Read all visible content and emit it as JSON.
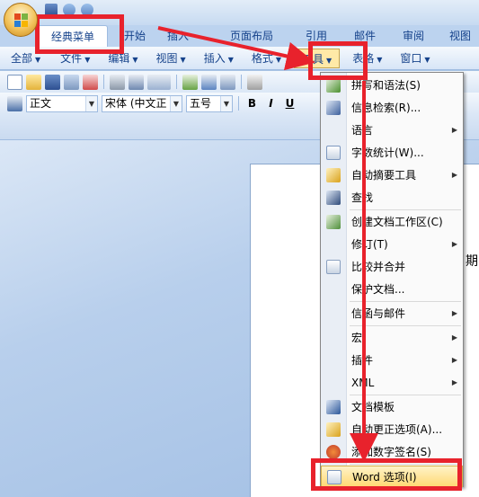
{
  "ribbon": {
    "tabs": [
      "经典菜单",
      "开始",
      "插入",
      "页面布局",
      "引用",
      "邮件",
      "审阅",
      "视图"
    ]
  },
  "menubar": {
    "items": [
      "全部",
      "文件",
      "编辑",
      "视图",
      "插入",
      "格式",
      "工具",
      "表格",
      "窗口"
    ]
  },
  "toolbar": {
    "style_value": "正文",
    "font_value": "宋体 (中文正",
    "size_value": "五号",
    "bold": "B",
    "italic": "I",
    "underline": "U"
  },
  "document": {
    "visible_text": "期"
  },
  "tools_menu": {
    "items": [
      {
        "label": "拼写和语法(S)",
        "submenu": false
      },
      {
        "label": "信息检索(R)...",
        "submenu": false
      },
      {
        "label": "语言",
        "submenu": true
      },
      {
        "label": "字数统计(W)...",
        "submenu": false
      },
      {
        "label": "自动摘要工具",
        "submenu": true
      },
      {
        "label": "查找",
        "submenu": false
      },
      {
        "label": "创建文档工作区(C)",
        "submenu": false
      },
      {
        "label": "修订(T)",
        "submenu": true
      },
      {
        "label": "比较并合并",
        "submenu": false
      },
      {
        "label": "保护文档...",
        "submenu": false
      },
      {
        "label": "信函与邮件",
        "submenu": true
      },
      {
        "label": "宏",
        "submenu": true
      },
      {
        "label": "插件",
        "submenu": true
      },
      {
        "label": "XML",
        "submenu": true
      },
      {
        "label": "文档模板",
        "submenu": false
      },
      {
        "label": "自动更正选项(A)...",
        "submenu": false
      },
      {
        "label": "添加数字签名(S)",
        "submenu": false
      },
      {
        "label": "Word 选项(I)",
        "submenu": false
      }
    ]
  },
  "colors": {
    "annotation": "#e8222c",
    "highlight": "#ffd975",
    "ribbon_text": "#15428b"
  }
}
